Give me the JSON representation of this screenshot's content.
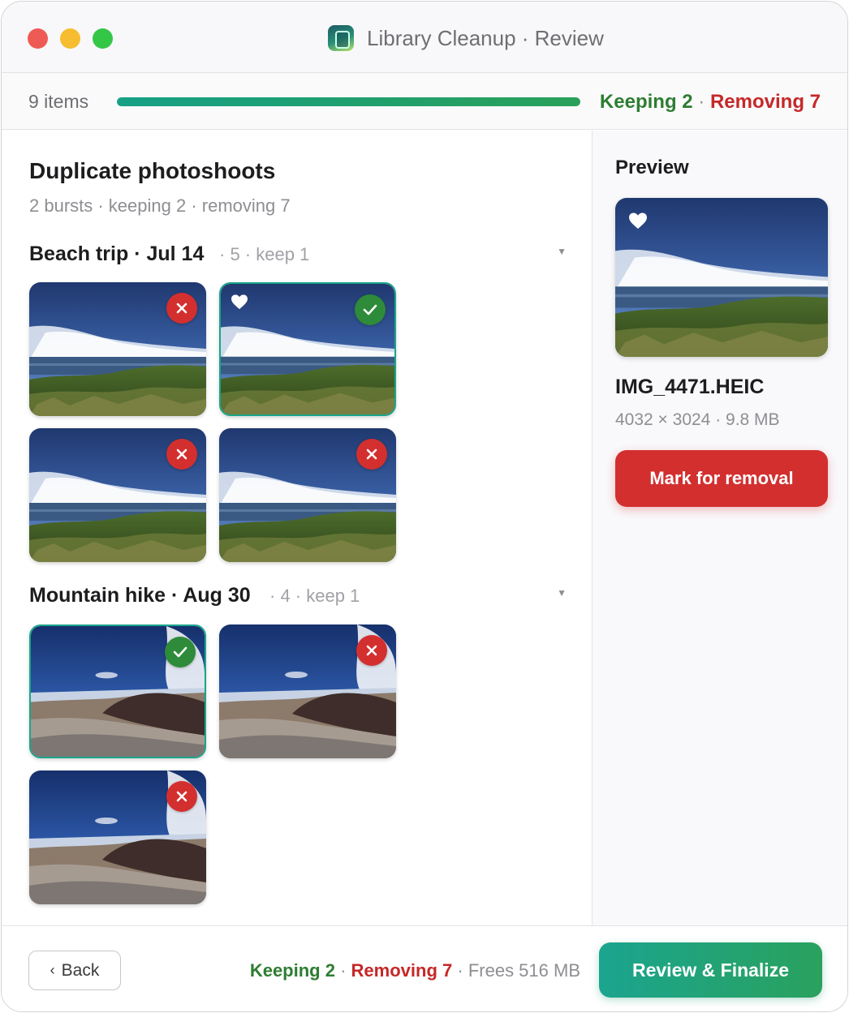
{
  "window": {
    "title": "Library Cleanup · Review"
  },
  "progress": {
    "items_label": "9 items",
    "fill_fraction": 1.0,
    "keeping_label": "Keeping 2",
    "separator": "·",
    "removing_label": "Removing 7"
  },
  "main": {
    "title": "Duplicate photoshoots",
    "subtitle": "2 bursts · keeping 2 · removing 7",
    "groups": [
      {
        "title": "Beach trip · Jul 14",
        "meta": "· 5 · keep 1",
        "photos": [
          {
            "scene": "coast",
            "status": "remove",
            "favorite": false
          },
          {
            "scene": "coast",
            "status": "keep",
            "favorite": true
          },
          {
            "scene": "coast",
            "status": "remove",
            "favorite": false
          },
          {
            "scene": "coast",
            "status": "remove",
            "favorite": false
          }
        ]
      },
      {
        "title": "Mountain hike · Aug 30",
        "meta": "· 4 · keep 1",
        "photos": [
          {
            "scene": "mountain",
            "status": "keep",
            "favorite": false
          },
          {
            "scene": "mountain",
            "status": "remove",
            "favorite": false
          },
          {
            "scene": "mountain",
            "status": "remove",
            "favorite": false
          }
        ]
      }
    ]
  },
  "preview": {
    "label": "Preview",
    "favorite": true,
    "file_name": "IMG_4471.HEIC",
    "file_meta": "4032 × 3024 · 9.8 MB",
    "mark_button": "Mark for removal"
  },
  "footer": {
    "back_button": "Back",
    "keeping": "Keeping 2",
    "removing": "Removing 7",
    "frees": "Frees 516 MB",
    "finalize_button": "Review & Finalize"
  },
  "icons": {
    "remove": "x-icon",
    "keep": "checkmark-icon",
    "favorite": "heart-icon",
    "back": "chevron-left-icon",
    "collapse": "caret-down-icon"
  },
  "colors": {
    "keep": "#2e7d32",
    "remove": "#c62828",
    "accent": "#1ba58f"
  }
}
